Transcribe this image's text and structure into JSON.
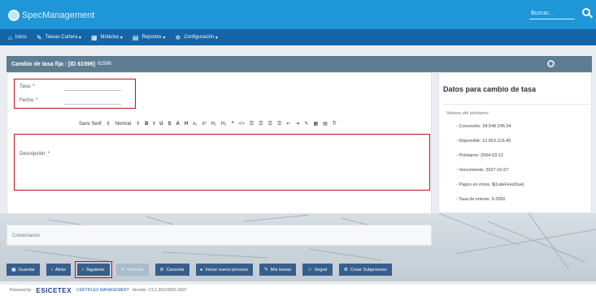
{
  "app": {
    "brand": "SpecManagement"
  },
  "search": {
    "placeholder": "Buscar..."
  },
  "menu": [
    {
      "label": "Inicio",
      "icon": "home-icon"
    },
    {
      "label": "Tareas Cartera",
      "icon": "wrench-icon"
    },
    {
      "label": "Módulos",
      "icon": "grid-icon"
    },
    {
      "label": "Reportes",
      "icon": "report-icon"
    },
    {
      "label": "Configuración",
      "icon": "gear-icon"
    }
  ],
  "panel": {
    "title": "Cambio de tasa fija : [ID 61596]",
    "title_extra": "61596"
  },
  "form": {
    "tasa_label": "Tasa: *",
    "fecha_label": "Fecha: *",
    "descripcion_label": "Descripción: *",
    "editor_toolbar": [
      "Sans Serif",
      "Normal",
      "B",
      "I",
      "U",
      "S",
      "A",
      "H",
      "x₂",
      "x²",
      "H₁",
      "H₂",
      "❝",
      "<>",
      "☰",
      "☰",
      "☰",
      "☰",
      "↵",
      "⇥",
      "✎",
      "▦",
      "▤",
      "T̸"
    ]
  },
  "side": {
    "title": "Datos para cambio de tasa",
    "subtitle": "Valores del préstamo:",
    "items": [
      "- Concesión: 28.546.245,54",
      "- Disponible: 12.653.216,40",
      "- Préstamo: 2004-03-12",
      "- Vencimiento: 2027-01-07",
      "- Pagos en mora: ${LateFeesDue}",
      "- Tasa de interés: 9.3300"
    ]
  },
  "comments": {
    "label": "Comentarios"
  },
  "actions": [
    {
      "label": "Guardar",
      "icon": "save-icon",
      "disabled": false
    },
    {
      "label": "Atrás",
      "icon": "back-icon",
      "disabled": false
    },
    {
      "label": "Siguiente",
      "icon": "next-icon",
      "disabled": false
    },
    {
      "label": "Eliminar",
      "icon": "delete-icon",
      "disabled": true
    },
    {
      "label": "Cancelar",
      "icon": "cancel-icon",
      "disabled": false
    },
    {
      "label": "Iniciar nuevo proceso",
      "icon": "process-icon",
      "disabled": false
    },
    {
      "label": "Mis tareas",
      "icon": "tasks-icon",
      "disabled": false
    },
    {
      "label": "Seguir",
      "icon": "follow-icon",
      "disabled": false
    },
    {
      "label": "Crear Subproceso",
      "icon": "subprocess-icon",
      "disabled": false
    }
  ],
  "footer": {
    "powered": "Powered by",
    "logo1": "ESICETEX",
    "logo2": "CERTIFLEX MANAGEMENT",
    "version": "Versión: 2.5.1.20210916-1507"
  },
  "colors": {
    "topbar": "#1e96d8",
    "menubar": "#1466a8",
    "panel_header": "#5e7d92",
    "button": "#375f8c",
    "highlight": "#c0101a"
  }
}
